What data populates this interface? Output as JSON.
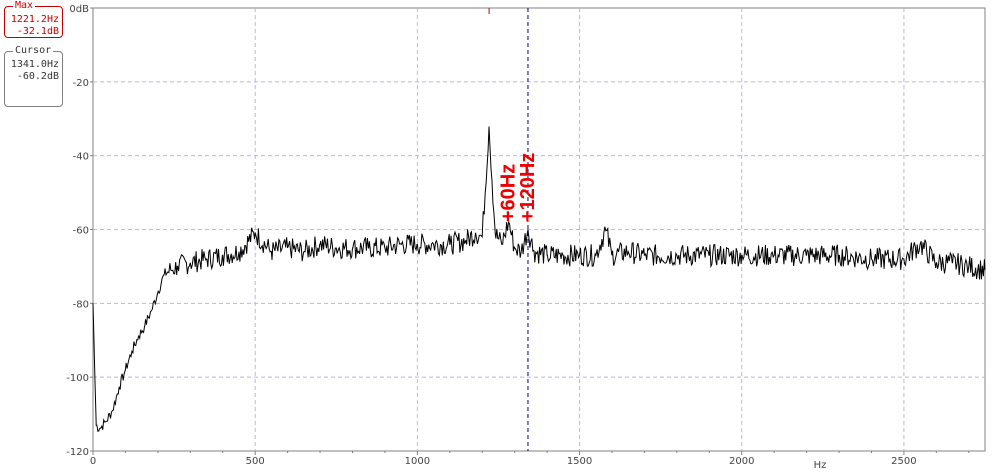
{
  "max_box": {
    "title": "Max",
    "freq": "1221.2Hz",
    "level": "-32.1dB"
  },
  "cursor_box": {
    "title": "Cursor",
    "freq": "1341.0Hz",
    "level": "-60.2dB"
  },
  "chart_data": {
    "type": "line",
    "xlabel": "Hz",
    "ylabel": "",
    "xlim": [
      0,
      2750
    ],
    "ylim": [
      -120,
      0
    ],
    "x_ticks": [
      "0",
      "500",
      "1000",
      "1500",
      "2000",
      "2500"
    ],
    "y_ticks": [
      "0dB",
      "-20",
      "-40",
      "-60",
      "-80",
      "-100",
      "-120"
    ],
    "grid": true,
    "cursor_x": 1341.0,
    "max_marker_x": 1221.2,
    "annotations": [
      {
        "text": "+60Hz",
        "x": 1281,
        "y": -58
      },
      {
        "text": "+120Hz",
        "x": 1341,
        "y": -58
      }
    ],
    "series": [
      {
        "color": "#000000",
        "x": [
          0,
          5,
          10,
          20,
          40,
          60,
          80,
          100,
          120,
          140,
          160,
          180,
          200,
          220,
          240,
          260,
          300,
          350,
          400,
          450,
          500,
          550,
          600,
          650,
          700,
          750,
          800,
          850,
          900,
          950,
          1000,
          1050,
          1100,
          1150,
          1180,
          1200,
          1221,
          1240,
          1260,
          1281,
          1300,
          1320,
          1341,
          1360,
          1400,
          1450,
          1500,
          1550,
          1580,
          1600,
          1650,
          1700,
          1800,
          1900,
          2000,
          2100,
          2200,
          2300,
          2400,
          2500,
          2550,
          2600,
          2650,
          2700,
          2750
        ],
        "y": [
          -80,
          -97,
          -113,
          -114,
          -112,
          -109,
          -103,
          -98,
          -93,
          -89,
          -86,
          -82,
          -77,
          -72,
          -71,
          -70,
          -69,
          -68,
          -67,
          -66,
          -61,
          -66,
          -65,
          -66,
          -64,
          -65,
          -65,
          -65,
          -65,
          -64,
          -64,
          -64,
          -64,
          -63,
          -61,
          -62,
          -32.1,
          -61,
          -64,
          -58,
          -65,
          -66,
          -60,
          -66,
          -67,
          -67,
          -67,
          -67,
          -60,
          -67,
          -66,
          -67,
          -67,
          -67,
          -67,
          -67,
          -67,
          -67,
          -68,
          -68,
          -64,
          -69,
          -69,
          -70,
          -71
        ]
      }
    ]
  }
}
